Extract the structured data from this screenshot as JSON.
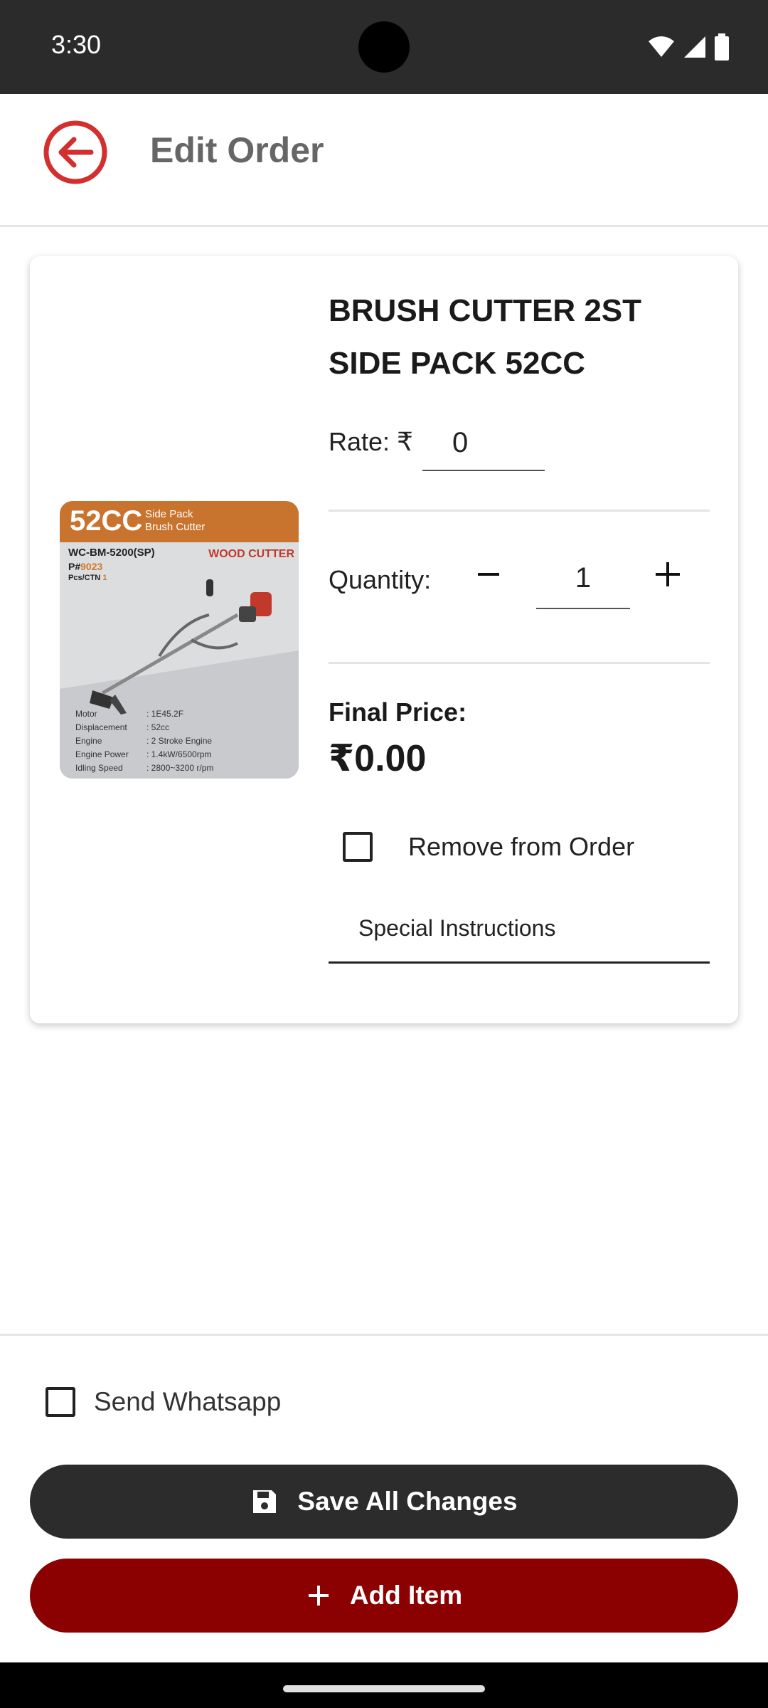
{
  "status_bar": {
    "time": "3:30"
  },
  "header": {
    "title": "Edit Order"
  },
  "product": {
    "name": "BRUSH CUTTER 2ST SIDE PACK 52CC",
    "image": {
      "capacity": "52CC",
      "subtitle_line1": "Side Pack",
      "subtitle_line2": "Brush Cutter",
      "model": "WC-BM-5200(SP)",
      "part_prefix": "P#",
      "part_number": "9023",
      "pcs_label": "Pcs/CTN",
      "pcs_value": "1",
      "brand": "WOOD CUTTER",
      "specs": [
        {
          "key": "Motor",
          "value": ": 1E45.2F"
        },
        {
          "key": "Displacement",
          "value": ": 52cc"
        },
        {
          "key": "Engine",
          "value": ": 2 Stroke Engine"
        },
        {
          "key": "Engine Power",
          "value": ": 1.4kW/6500rpm"
        },
        {
          "key": "Idling Speed",
          "value": ": 2800~3200 r/pm"
        }
      ]
    },
    "rate_label": "Rate: ₹",
    "rate_value": "0",
    "quantity_label": "Quantity:",
    "quantity_value": "1",
    "final_price_label": "Final Price:",
    "final_price_value": "₹0.00",
    "remove_label": "Remove from Order",
    "remove_checked": false,
    "special_instructions_label": "Special Instructions"
  },
  "footer": {
    "send_whatsapp_label": "Send Whatsapp",
    "send_whatsapp_checked": false,
    "save_button_label": "Save All Changes",
    "add_button_label": "Add Item"
  },
  "colors": {
    "accent_red": "#d32f2f",
    "add_button": "#8b0000",
    "save_button": "#2c2c2c",
    "status_bar": "#2b2b2b"
  }
}
